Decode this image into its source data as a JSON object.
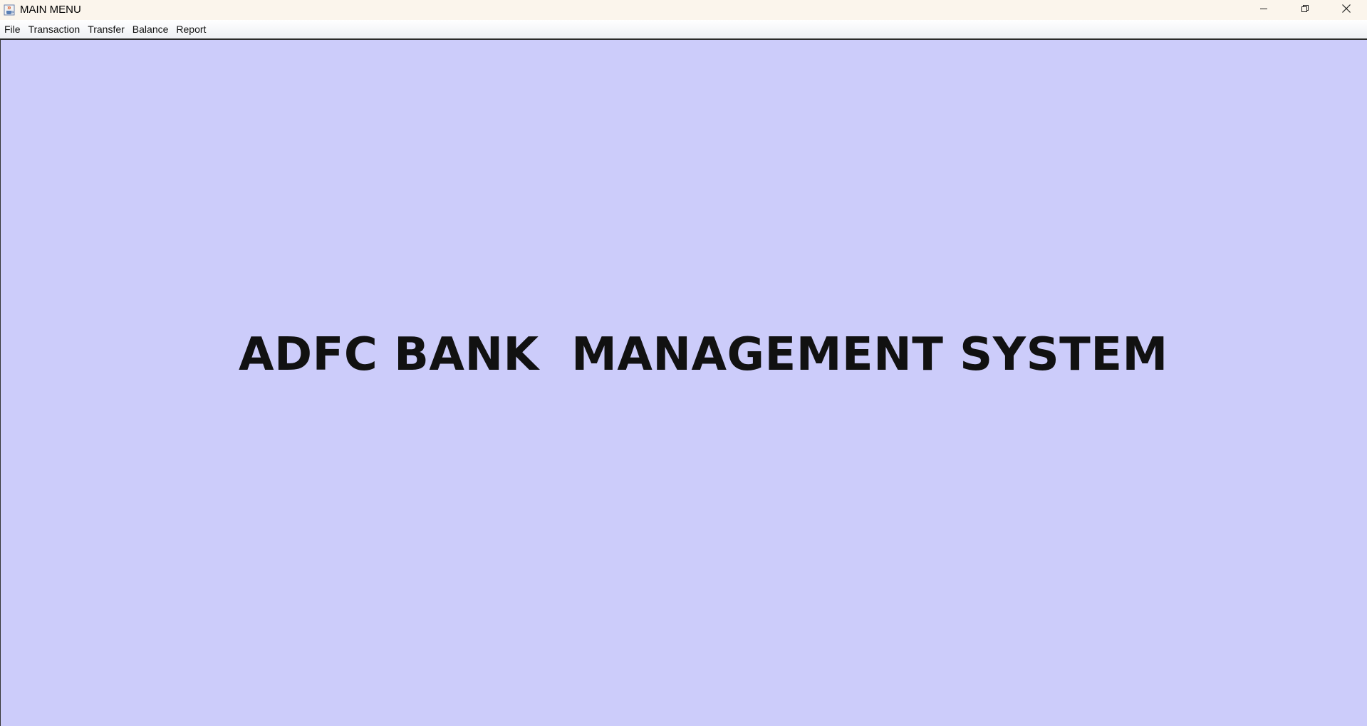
{
  "window": {
    "title": "MAIN MENU",
    "app_icon": "java-cup-icon",
    "controls": {
      "minimize_icon": "minimize-icon",
      "maximize_icon": "restore-icon",
      "close_icon": "close-icon"
    }
  },
  "menubar": {
    "items": [
      {
        "label": "File"
      },
      {
        "label": "Transaction"
      },
      {
        "label": "Transfer"
      },
      {
        "label": "Balance"
      },
      {
        "label": "Report"
      }
    ]
  },
  "main": {
    "heading": "ADFC BANK  MANAGEMENT SYSTEM",
    "background_color": "#ccccfa"
  }
}
